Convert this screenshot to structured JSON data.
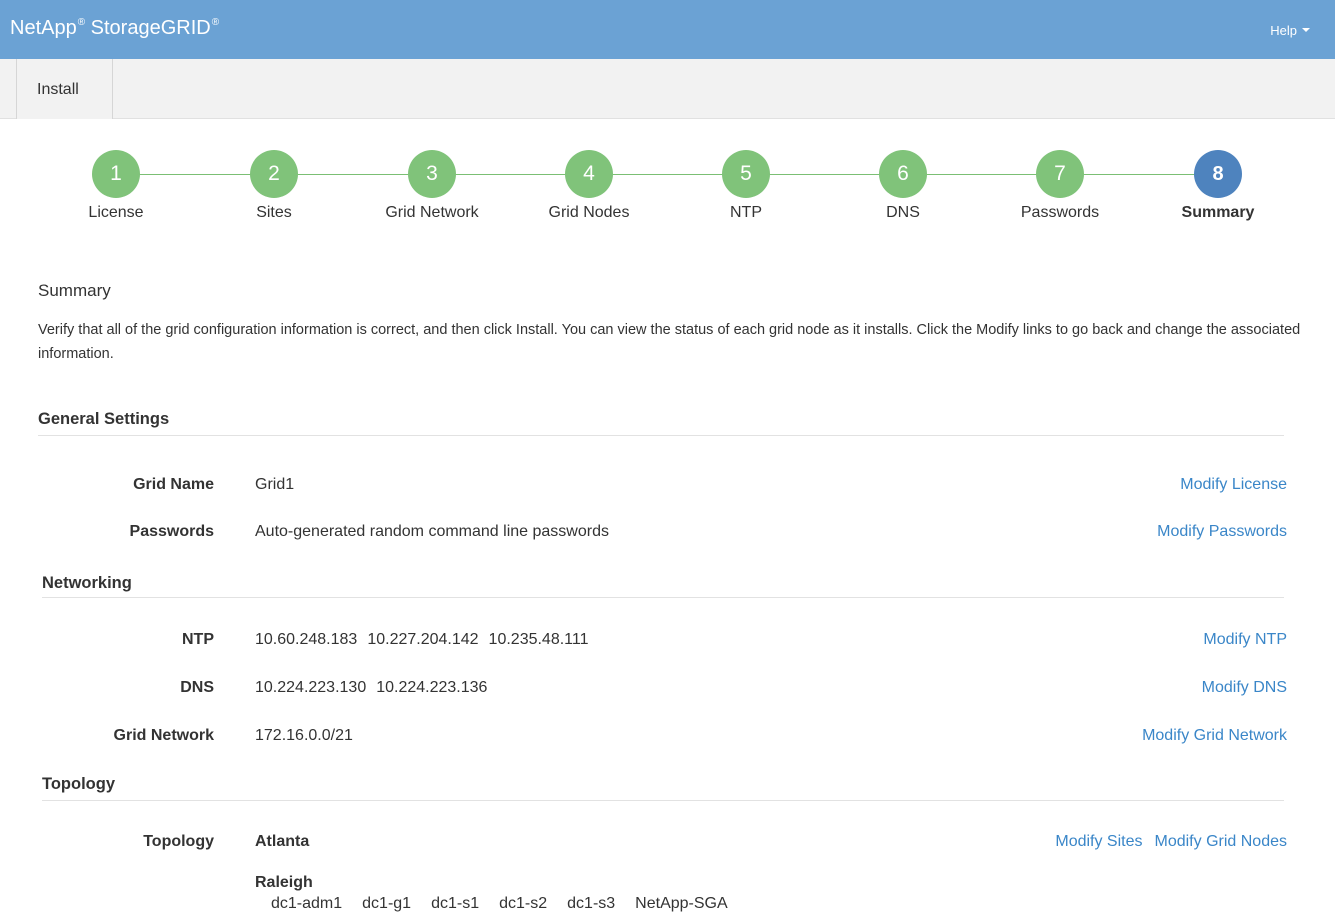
{
  "header": {
    "brand_netapp": "NetApp",
    "brand_reg1": "®",
    "brand_product": "StorageGRID",
    "brand_reg2": "®",
    "help_label": "Help",
    "bg_color": "#6ba2d4"
  },
  "tabs": {
    "install_label": "Install"
  },
  "steps": [
    {
      "number": "1",
      "label": "License",
      "status": "complete"
    },
    {
      "number": "2",
      "label": "Sites",
      "status": "complete"
    },
    {
      "number": "3",
      "label": "Grid Network",
      "status": "complete"
    },
    {
      "number": "4",
      "label": "Grid Nodes",
      "status": "complete"
    },
    {
      "number": "5",
      "label": "NTP",
      "status": "complete"
    },
    {
      "number": "6",
      "label": "DNS",
      "status": "complete"
    },
    {
      "number": "7",
      "label": "Passwords",
      "status": "complete"
    },
    {
      "number": "8",
      "label": "Summary",
      "status": "active"
    }
  ],
  "step_colors": {
    "complete": "#80c37a",
    "active": "#4e83be"
  },
  "summary": {
    "title": "Summary",
    "intro": "Verify that all of the grid configuration information is correct, and then click Install. You can view the status of each grid node as it installs. Click the Modify links to go back and change the associated information."
  },
  "general": {
    "heading": "General Settings",
    "grid_name": {
      "label": "Grid Name",
      "value": "Grid1",
      "link": "Modify License"
    },
    "passwords": {
      "label": "Passwords",
      "value": "Auto-generated random command line passwords",
      "link": "Modify Passwords"
    }
  },
  "networking": {
    "heading": "Networking",
    "ntp": {
      "label": "NTP",
      "values": [
        "10.60.248.183",
        "10.227.204.142",
        "10.235.48.111"
      ],
      "link": "Modify NTP"
    },
    "dns": {
      "label": "DNS",
      "values": [
        "10.224.223.130",
        "10.224.223.136"
      ],
      "link": "Modify DNS"
    },
    "grid_network": {
      "label": "Grid Network",
      "value": "172.16.0.0/21",
      "link": "Modify Grid Network"
    }
  },
  "topology": {
    "heading": "Topology",
    "label": "Topology",
    "link_sites": "Modify Sites",
    "link_nodes": "Modify Grid Nodes",
    "sites": [
      {
        "name": "Atlanta",
        "nodes": []
      },
      {
        "name": "Raleigh",
        "nodes": [
          "dc1-adm1",
          "dc1-g1",
          "dc1-s1",
          "dc1-s2",
          "dc1-s3",
          "NetApp-SGA"
        ]
      }
    ]
  },
  "link_color": "#3a86c8"
}
